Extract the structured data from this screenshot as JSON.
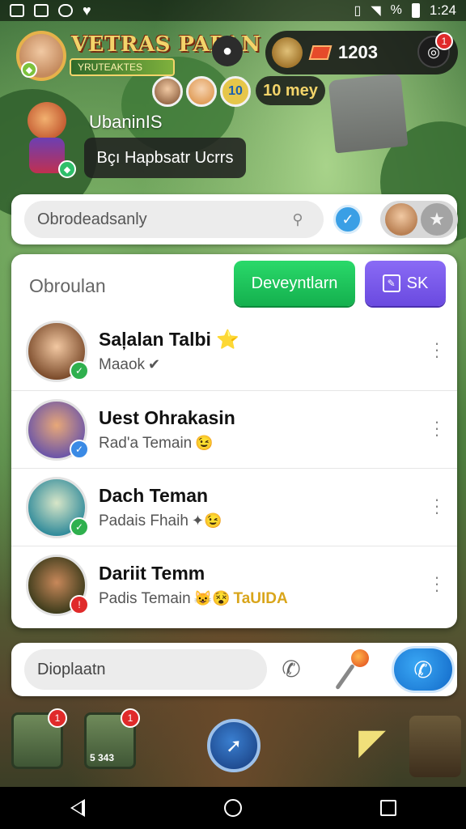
{
  "status_bar": {
    "time": "1:24",
    "battery": "%",
    "icons": [
      "app-icon",
      "photo-icon",
      "gamepad-icon",
      "heart-icon",
      "vibrate-icon",
      "wifi-icon",
      "signal-icon",
      "battery-icon"
    ]
  },
  "hud": {
    "game_title": "VETRAS PAPAN",
    "game_subtitle": "YRUTEAKTES",
    "currency_amount": "1203",
    "notification_count": "1",
    "level_badge": "10",
    "days_label": "10 mey"
  },
  "character": {
    "username": "UbaninIS",
    "speech": "Bçı Hapbsatr Ucrrs"
  },
  "search": {
    "placeholder": "Obrodeadsanly"
  },
  "panel": {
    "title": "Obroulan",
    "primary_button": "Deveyntlarn",
    "secondary_button": "SK"
  },
  "contacts": [
    {
      "name": "Saļalan Talbi",
      "name_suffix": "⭐",
      "status": "Maaok",
      "status_emoji": "✔",
      "badge": "check",
      "badge_color": "#2fb04e"
    },
    {
      "name": "Uest Ohrakasin",
      "status": "Rad'a Temain",
      "status_emoji": "😉",
      "badge": "verified",
      "badge_color": "#3a8ae5"
    },
    {
      "name": "Dach Teman",
      "status": "Padais Fhaih",
      "status_emoji": "✦😉",
      "badge": "check",
      "badge_color": "#2fb04e"
    },
    {
      "name": "Dariit Temm",
      "status": "Padis Temain",
      "status_emoji": "😺😵",
      "status_tag": "TaUIDA",
      "badge": "alert",
      "badge_color": "#e02a2a"
    }
  ],
  "message_bar": {
    "placeholder": "Dioplaatn"
  },
  "dock": {
    "item1_count": "1",
    "item2_count": "1",
    "item2_sub": "5 343"
  },
  "colors": {
    "accent_green": "#14b04e",
    "accent_purple": "#6a4ae0",
    "accent_blue": "#1269c8",
    "alert_red": "#e02a2a"
  }
}
